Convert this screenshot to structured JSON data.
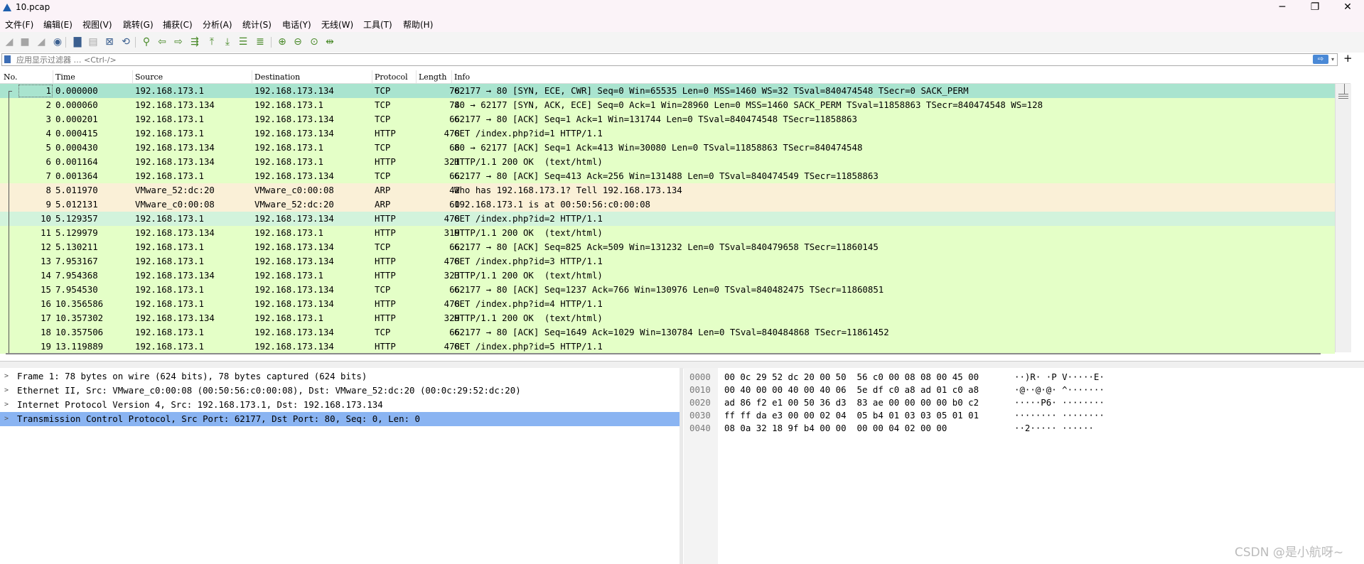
{
  "window": {
    "title": "10.pcap",
    "controls": {
      "minimize": "─",
      "restore": "❐",
      "close": "✕"
    }
  },
  "menu": [
    "文件(F)",
    "编辑(E)",
    "视图(V)",
    "跳转(G)",
    "捕获(C)",
    "分析(A)",
    "统计(S)",
    "电话(Y)",
    "无线(W)",
    "工具(T)",
    "帮助(H)"
  ],
  "toolbar": {
    "icons": [
      {
        "name": "start-capture-icon",
        "glyph": "◢",
        "disabled": true
      },
      {
        "name": "stop-capture-icon",
        "glyph": "■",
        "disabled": true
      },
      {
        "name": "restart-capture-icon",
        "glyph": "◢",
        "disabled": true
      },
      {
        "name": "capture-options-icon",
        "glyph": "◉",
        "disabled": false
      },
      {
        "name": "open-file-icon",
        "glyph": "▇",
        "disabled": false
      },
      {
        "name": "save-file-icon",
        "glyph": "▤",
        "disabled": true
      },
      {
        "name": "close-file-icon",
        "glyph": "⊠",
        "disabled": false
      },
      {
        "name": "reload-file-icon",
        "glyph": "⟲",
        "disabled": false
      },
      {
        "name": "find-packet-icon",
        "glyph": "⚲",
        "disabled": false
      },
      {
        "name": "go-back-icon",
        "glyph": "⇦",
        "disabled": false
      },
      {
        "name": "go-forward-icon",
        "glyph": "⇨",
        "disabled": false
      },
      {
        "name": "go-to-packet-icon",
        "glyph": "⇶",
        "disabled": false
      },
      {
        "name": "go-first-icon",
        "glyph": "⤒",
        "disabled": false
      },
      {
        "name": "go-last-icon",
        "glyph": "⤓",
        "disabled": false
      },
      {
        "name": "auto-scroll-icon",
        "glyph": "☰",
        "disabled": false
      },
      {
        "name": "colorize-icon",
        "glyph": "≣",
        "disabled": false
      },
      {
        "name": "zoom-in-icon",
        "glyph": "⊕",
        "disabled": false
      },
      {
        "name": "zoom-out-icon",
        "glyph": "⊖",
        "disabled": false
      },
      {
        "name": "zoom-normal-icon",
        "glyph": "⊙",
        "disabled": false
      },
      {
        "name": "resize-columns-icon",
        "glyph": "⇹",
        "disabled": false
      }
    ]
  },
  "filter": {
    "placeholder": "应用显示过滤器 … <Ctrl-/>",
    "apply": "⇨",
    "dropdown": "▾",
    "add": "+"
  },
  "packet_list": {
    "columns": [
      "No.",
      "Time",
      "Source",
      "Destination",
      "Protocol",
      "Length",
      "Info"
    ],
    "colors": {
      "tcp": "#e4ffc7",
      "http": "#e4ffc7",
      "arp": "#faf0d7",
      "selected": "#a9e4cf",
      "marked": "#d2f3dc"
    },
    "rows": [
      {
        "no": "1",
        "time": "0.000000",
        "src": "192.168.173.1",
        "dst": "192.168.173.134",
        "proto": "TCP",
        "len": "78",
        "info": "62177 → 80 [SYN, ECE, CWR] Seq=0 Win=65535 Len=0 MSS=1460 WS=32 TSval=840474548 TSecr=0 SACK_PERM",
        "kind": "selected"
      },
      {
        "no": "2",
        "time": "0.000060",
        "src": "192.168.173.134",
        "dst": "192.168.173.1",
        "proto": "TCP",
        "len": "74",
        "info": "80 → 62177 [SYN, ACK, ECE] Seq=0 Ack=1 Win=28960 Len=0 MSS=1460 SACK_PERM TSval=11858863 TSecr=840474548 WS=128",
        "kind": "tcp"
      },
      {
        "no": "3",
        "time": "0.000201",
        "src": "192.168.173.1",
        "dst": "192.168.173.134",
        "proto": "TCP",
        "len": "66",
        "info": "62177 → 80 [ACK] Seq=1 Ack=1 Win=131744 Len=0 TSval=840474548 TSecr=11858863",
        "kind": "tcp"
      },
      {
        "no": "4",
        "time": "0.000415",
        "src": "192.168.173.1",
        "dst": "192.168.173.134",
        "proto": "HTTP",
        "len": "478",
        "info": "GET /index.php?id=1 HTTP/1.1",
        "kind": "http"
      },
      {
        "no": "5",
        "time": "0.000430",
        "src": "192.168.173.134",
        "dst": "192.168.173.1",
        "proto": "TCP",
        "len": "66",
        "info": "80 → 62177 [ACK] Seq=1 Ack=413 Win=30080 Len=0 TSval=11858863 TSecr=840474548",
        "kind": "tcp"
      },
      {
        "no": "6",
        "time": "0.001164",
        "src": "192.168.173.134",
        "dst": "192.168.173.1",
        "proto": "HTTP",
        "len": "321",
        "info": "HTTP/1.1 200 OK  (text/html)",
        "kind": "http"
      },
      {
        "no": "7",
        "time": "0.001364",
        "src": "192.168.173.1",
        "dst": "192.168.173.134",
        "proto": "TCP",
        "len": "66",
        "info": "62177 → 80 [ACK] Seq=413 Ack=256 Win=131488 Len=0 TSval=840474549 TSecr=11858863",
        "kind": "tcp"
      },
      {
        "no": "8",
        "time": "5.011970",
        "src": "VMware_52:dc:20",
        "dst": "VMware_c0:00:08",
        "proto": "ARP",
        "len": "42",
        "info": "Who has 192.168.173.1? Tell 192.168.173.134",
        "kind": "arp"
      },
      {
        "no": "9",
        "time": "5.012131",
        "src": "VMware_c0:00:08",
        "dst": "VMware_52:dc:20",
        "proto": "ARP",
        "len": "60",
        "info": "192.168.173.1 is at 00:50:56:c0:00:08",
        "kind": "arp"
      },
      {
        "no": "10",
        "time": "5.129357",
        "src": "192.168.173.1",
        "dst": "192.168.173.134",
        "proto": "HTTP",
        "len": "478",
        "info": "GET /index.php?id=2 HTTP/1.1",
        "kind": "marked"
      },
      {
        "no": "11",
        "time": "5.129979",
        "src": "192.168.173.134",
        "dst": "192.168.173.1",
        "proto": "HTTP",
        "len": "319",
        "info": "HTTP/1.1 200 OK  (text/html)",
        "kind": "http"
      },
      {
        "no": "12",
        "time": "5.130211",
        "src": "192.168.173.1",
        "dst": "192.168.173.134",
        "proto": "TCP",
        "len": "66",
        "info": "62177 → 80 [ACK] Seq=825 Ack=509 Win=131232 Len=0 TSval=840479658 TSecr=11860145",
        "kind": "tcp"
      },
      {
        "no": "13",
        "time": "7.953167",
        "src": "192.168.173.1",
        "dst": "192.168.173.134",
        "proto": "HTTP",
        "len": "478",
        "info": "GET /index.php?id=3 HTTP/1.1",
        "kind": "http"
      },
      {
        "no": "14",
        "time": "7.954368",
        "src": "192.168.173.134",
        "dst": "192.168.173.1",
        "proto": "HTTP",
        "len": "323",
        "info": "HTTP/1.1 200 OK  (text/html)",
        "kind": "http"
      },
      {
        "no": "15",
        "time": "7.954530",
        "src": "192.168.173.1",
        "dst": "192.168.173.134",
        "proto": "TCP",
        "len": "66",
        "info": "62177 → 80 [ACK] Seq=1237 Ack=766 Win=130976 Len=0 TSval=840482475 TSecr=11860851",
        "kind": "tcp"
      },
      {
        "no": "16",
        "time": "10.356586",
        "src": "192.168.173.1",
        "dst": "192.168.173.134",
        "proto": "HTTP",
        "len": "478",
        "info": "GET /index.php?id=4 HTTP/1.1",
        "kind": "http"
      },
      {
        "no": "17",
        "time": "10.357302",
        "src": "192.168.173.134",
        "dst": "192.168.173.1",
        "proto": "HTTP",
        "len": "329",
        "info": "HTTP/1.1 200 OK  (text/html)",
        "kind": "http"
      },
      {
        "no": "18",
        "time": "10.357506",
        "src": "192.168.173.1",
        "dst": "192.168.173.134",
        "proto": "TCP",
        "len": "66",
        "info": "62177 → 80 [ACK] Seq=1649 Ack=1029 Win=130784 Len=0 TSval=840484868 TSecr=11861452",
        "kind": "tcp"
      },
      {
        "no": "19",
        "time": "13.119889",
        "src": "192.168.173.1",
        "dst": "192.168.173.134",
        "proto": "HTTP",
        "len": "478",
        "info": "GET /index.php?id=5 HTTP/1.1",
        "kind": "http"
      }
    ]
  },
  "details": [
    {
      "text": "Frame 1: 78 bytes on wire (624 bits), 78 bytes captured (624 bits)",
      "selected": false
    },
    {
      "text": "Ethernet II, Src: VMware_c0:00:08 (00:50:56:c0:00:08), Dst: VMware_52:dc:20 (00:0c:29:52:dc:20)",
      "selected": false
    },
    {
      "text": "Internet Protocol Version 4, Src: 192.168.173.1, Dst: 192.168.173.134",
      "selected": false
    },
    {
      "text": "Transmission Control Protocol, Src Port: 62177, Dst Port: 80, Seq: 0, Len: 0",
      "selected": true
    }
  ],
  "details_arrow": ">",
  "bytes": [
    {
      "offset": "0000",
      "hex": "00 0c 29 52 dc 20 00 50  56 c0 00 08 08 00 45 00",
      "ascii": "··)R· ·P V·····E·"
    },
    {
      "offset": "0010",
      "hex": "00 40 00 00 40 00 40 06  5e df c0 a8 ad 01 c0 a8",
      "ascii": "·@··@·@· ^·······"
    },
    {
      "offset": "0020",
      "hex": "ad 86 f2 e1 00 50 36 d3  83 ae 00 00 00 00 b0 c2",
      "ascii": "·····P6· ········"
    },
    {
      "offset": "0030",
      "hex": "ff ff da e3 00 00 02 04  05 b4 01 03 03 05 01 01",
      "ascii": "········ ········"
    },
    {
      "offset": "0040",
      "hex": "08 0a 32 18 9f b4 00 00  00 00 04 02 00 00",
      "ascii": "··2····· ······"
    }
  ],
  "watermark": "CSDN @是小航呀~"
}
